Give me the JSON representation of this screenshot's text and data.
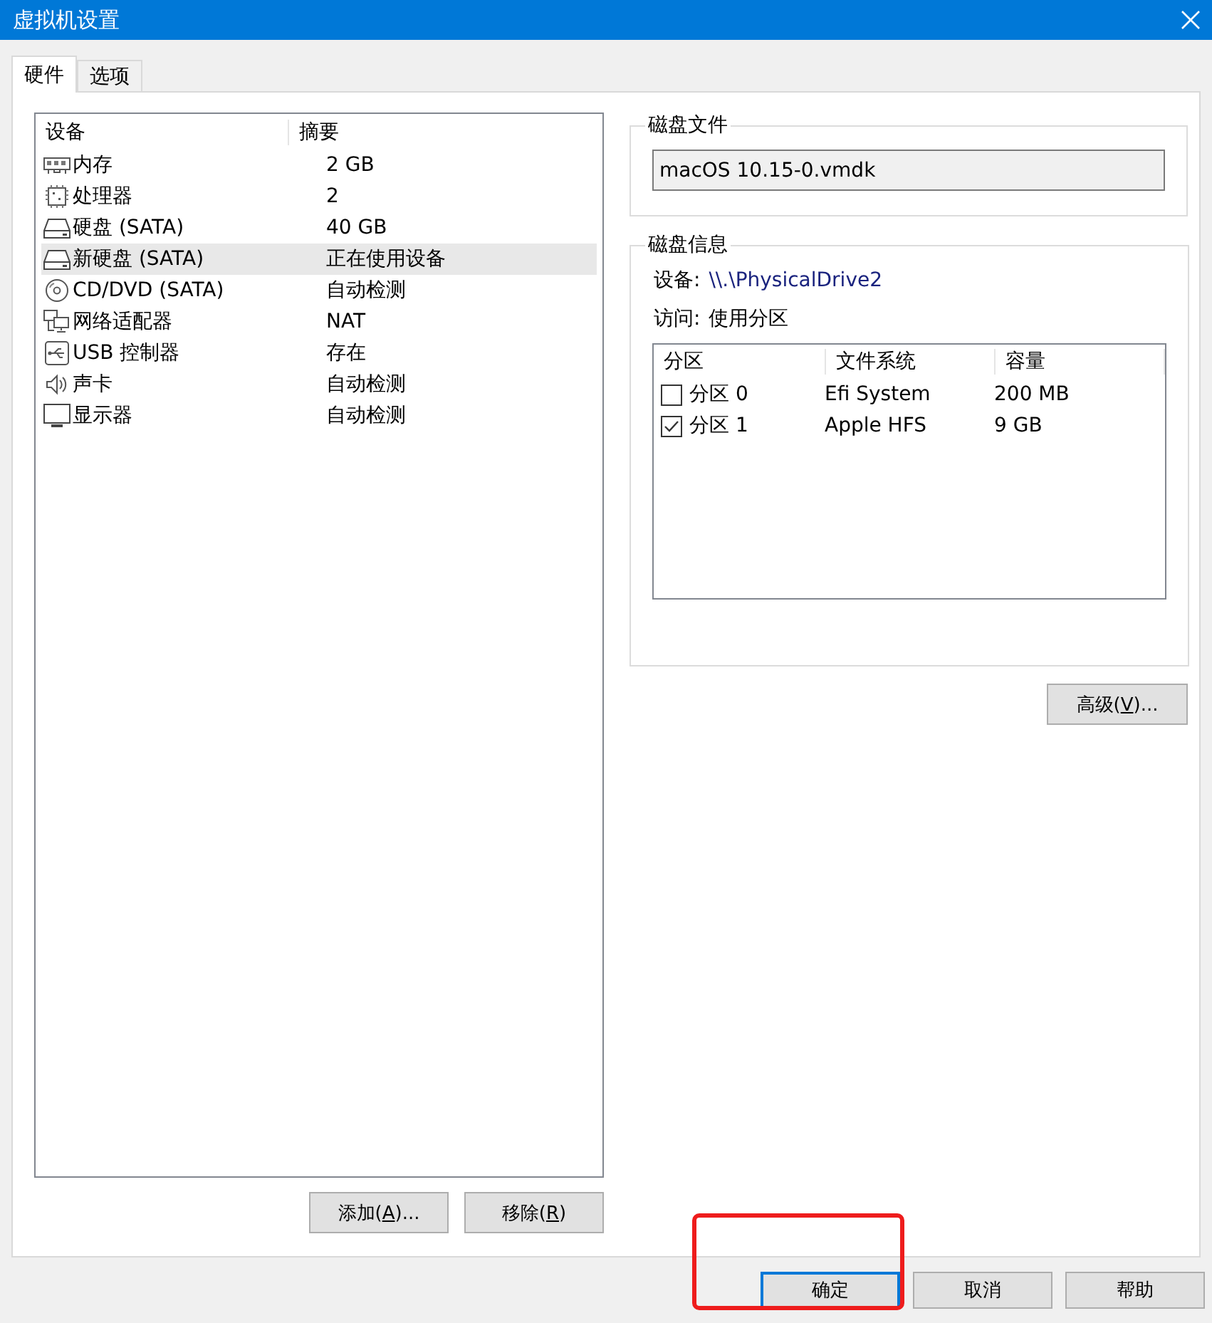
{
  "window": {
    "title": "虚拟机设置"
  },
  "tabs": [
    {
      "label": "硬件",
      "selected": true
    },
    {
      "label": "选项",
      "selected": false
    }
  ],
  "devices": {
    "columns": [
      "设备",
      "摘要"
    ],
    "rows": [
      {
        "kind": "memory",
        "name": "内存",
        "summary": "2 GB",
        "selected": false
      },
      {
        "kind": "processor",
        "name": "处理器",
        "summary": "2",
        "selected": false
      },
      {
        "kind": "disk",
        "name": "硬盘 (SATA)",
        "summary": "40 GB",
        "selected": false
      },
      {
        "kind": "disk",
        "name": "新硬盘 (SATA)",
        "summary": "正在使用设备",
        "selected": true
      },
      {
        "kind": "cdrom",
        "name": "CD/DVD (SATA)",
        "summary": "自动检测",
        "selected": false
      },
      {
        "kind": "network",
        "name": "网络适配器",
        "summary": "NAT",
        "selected": false
      },
      {
        "kind": "usb",
        "name": "USB 控制器",
        "summary": "存在",
        "selected": false
      },
      {
        "kind": "sound",
        "name": "声卡",
        "summary": "自动检测",
        "selected": false
      },
      {
        "kind": "display",
        "name": "显示器",
        "summary": "自动检测",
        "selected": false
      }
    ],
    "buttons": [
      {
        "before": "添加(",
        "key": "A",
        "after": ")..."
      },
      {
        "before": "移除(",
        "key": "R",
        "after": ")"
      }
    ]
  },
  "disk_file": {
    "title": "磁盘文件",
    "value": "macOS 10.15-0.vmdk"
  },
  "disk_info": {
    "title": "磁盘信息",
    "device_label": "设备:",
    "device_value": "\\\\.\\PhysicalDrive2",
    "access_label": "访问:",
    "access_value": "使用分区",
    "columns": [
      "分区",
      "文件系统",
      "容量"
    ],
    "partitions": [
      {
        "name": "分区 0",
        "filesystem": "Efi System",
        "size": "200 MB",
        "checked": false
      },
      {
        "name": "分区 1",
        "filesystem": "Apple HFS",
        "size": "9 GB",
        "checked": true
      }
    ]
  },
  "advanced_button": {
    "before": "高级(",
    "key": "V",
    "after": ")..."
  },
  "footer_buttons": [
    {
      "label": "确定",
      "default": true
    },
    {
      "label": "取消",
      "default": false
    },
    {
      "label": "帮助",
      "default": false
    }
  ],
  "annotation": {
    "kind": "outline"
  }
}
